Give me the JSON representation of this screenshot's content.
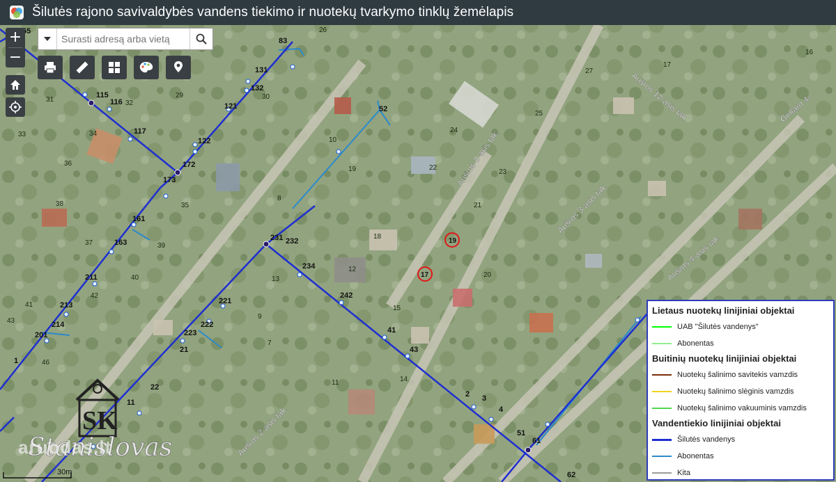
{
  "header": {
    "title": "Šilutės rajono savivaldybės vandens tiekimo ir nuotekų tvarkymo tinklų žemėlapis"
  },
  "search": {
    "placeholder": "Surasti adresą arba vietą"
  },
  "map_controls": {
    "zoom_in": "+",
    "zoom_out": "−",
    "icons": [
      "home-icon",
      "locate-icon",
      "print-icon",
      "measure-icon",
      "basemap-gallery-icon",
      "palette-icon",
      "marker-icon",
      "search-icon",
      "dropdown-icon"
    ]
  },
  "scale": {
    "label": "30m"
  },
  "watermark": {
    "brand": "aruodas.lt",
    "logo_initials": "SK",
    "logo_name": "Stanislovas"
  },
  "street_labels": [
    "Aušros 2-asis tak.",
    "Aušros 3-asis tak.",
    "Aušros 4-asis tak.",
    "Aušros 12-asis tak.",
    "Aušros 2-asis tak.",
    "Gintaro 4-"
  ],
  "node_labels": [
    "55",
    "83",
    "131",
    "132",
    "115",
    "116",
    "121",
    "117",
    "122",
    "172",
    "173",
    "161",
    "163",
    "211",
    "213",
    "214",
    "201",
    "221",
    "222",
    "223",
    "231",
    "232",
    "234",
    "242",
    "41",
    "43",
    "51",
    "52",
    "2",
    "3",
    "4",
    "61",
    "62",
    "22",
    "21",
    "11",
    "1"
  ],
  "parcel_numbers": [
    "26",
    "17",
    "27",
    "16",
    "23",
    "30",
    "29",
    "31",
    "33",
    "34",
    "36",
    "35",
    "37",
    "38",
    "40",
    "39",
    "42",
    "41",
    "43",
    "46",
    "21",
    "24",
    "25",
    "20",
    "22",
    "19",
    "18",
    "15",
    "14",
    "13",
    "12",
    "10",
    "9",
    "8",
    "7",
    "11",
    "32"
  ],
  "highlighted_parcels": [
    "19",
    "17"
  ],
  "legend": {
    "sections": [
      {
        "title": "Lietaus nuotekų linijiniai objektai",
        "items": [
          {
            "label": "UAB \"Šilutės vandenys\"",
            "color": "#00ff00"
          },
          {
            "label": "Abonentas",
            "color": "#90ee90"
          }
        ]
      },
      {
        "title": "Buitinių nuotekų linijiniai objektai",
        "items": [
          {
            "label": "Nuotekų šalinimo savitekis vamzdis",
            "color": "#7b2d0a"
          },
          {
            "label": "Nuotekų šalinimo slėginis vamzdis",
            "color": "#f2d21b"
          },
          {
            "label": "Nuotekų šalinimo vakuuminis vamzdis",
            "color": "#4dd84d"
          }
        ]
      },
      {
        "title": "Vandentiekio linijiniai objektai",
        "items": [
          {
            "label": "Šilutės vandenys",
            "color": "#1e2fd0"
          },
          {
            "label": "Abonentas",
            "color": "#2b8acb"
          },
          {
            "label": "Kita",
            "color": "#9a9a9a"
          }
        ]
      }
    ]
  }
}
